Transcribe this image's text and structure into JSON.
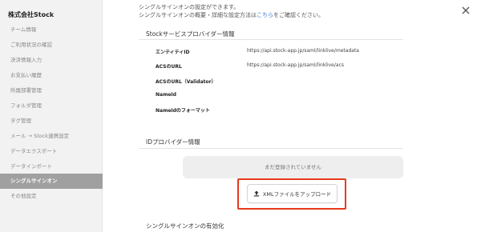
{
  "sidebar": {
    "company": "株式会社Stock",
    "items": [
      {
        "label": "チーム情報"
      },
      {
        "label": "ご利用状況の確認"
      },
      {
        "label": "決済情報入力"
      },
      {
        "label": "お支払い履歴"
      },
      {
        "label": "所属部署管理"
      },
      {
        "label": "フォルダ管理"
      },
      {
        "label": "タグ管理"
      },
      {
        "label": "メール → Stock連携設定"
      },
      {
        "label": "データエクスポート"
      },
      {
        "label": "データインポート"
      },
      {
        "label": "シングルサインオン"
      },
      {
        "label": "その他設定"
      }
    ],
    "active_index": 10
  },
  "main": {
    "intro_line1": "シングルサインオンの設定ができます。",
    "intro_line2_prefix": "シングルサインオンの概要・詳細な設定方法は",
    "intro_link": "こちら",
    "intro_line2_suffix": "をご確認ください。",
    "sp_section": {
      "title": "Stockサービスプロバイダー情報",
      "rows": [
        {
          "label": "エンティティID",
          "value": "https://api.stock-app.jp/saml/linklive/metadata"
        },
        {
          "label": "ACSのURL",
          "value": "https://api.stock-app.jp/saml/linklive/acs"
        },
        {
          "label": "ACSのURL（Validator）",
          "value": ""
        },
        {
          "label": "NameId",
          "value": ""
        },
        {
          "label": "NameIdのフォーマット",
          "value": ""
        }
      ]
    },
    "idp_section": {
      "title": "IDプロバイダー情報",
      "empty_text": "まだ登録されていません",
      "upload_label": "XMLファイルをアップロード"
    },
    "enable_section": {
      "title": "シングルサインオンの有効化"
    }
  },
  "colors": {
    "highlight": "#e8391c",
    "link": "#3b7fd4",
    "sidebar_active_bg": "#a0a0a0"
  },
  "icons": {
    "close": "close-icon",
    "upload": "upload-icon"
  }
}
